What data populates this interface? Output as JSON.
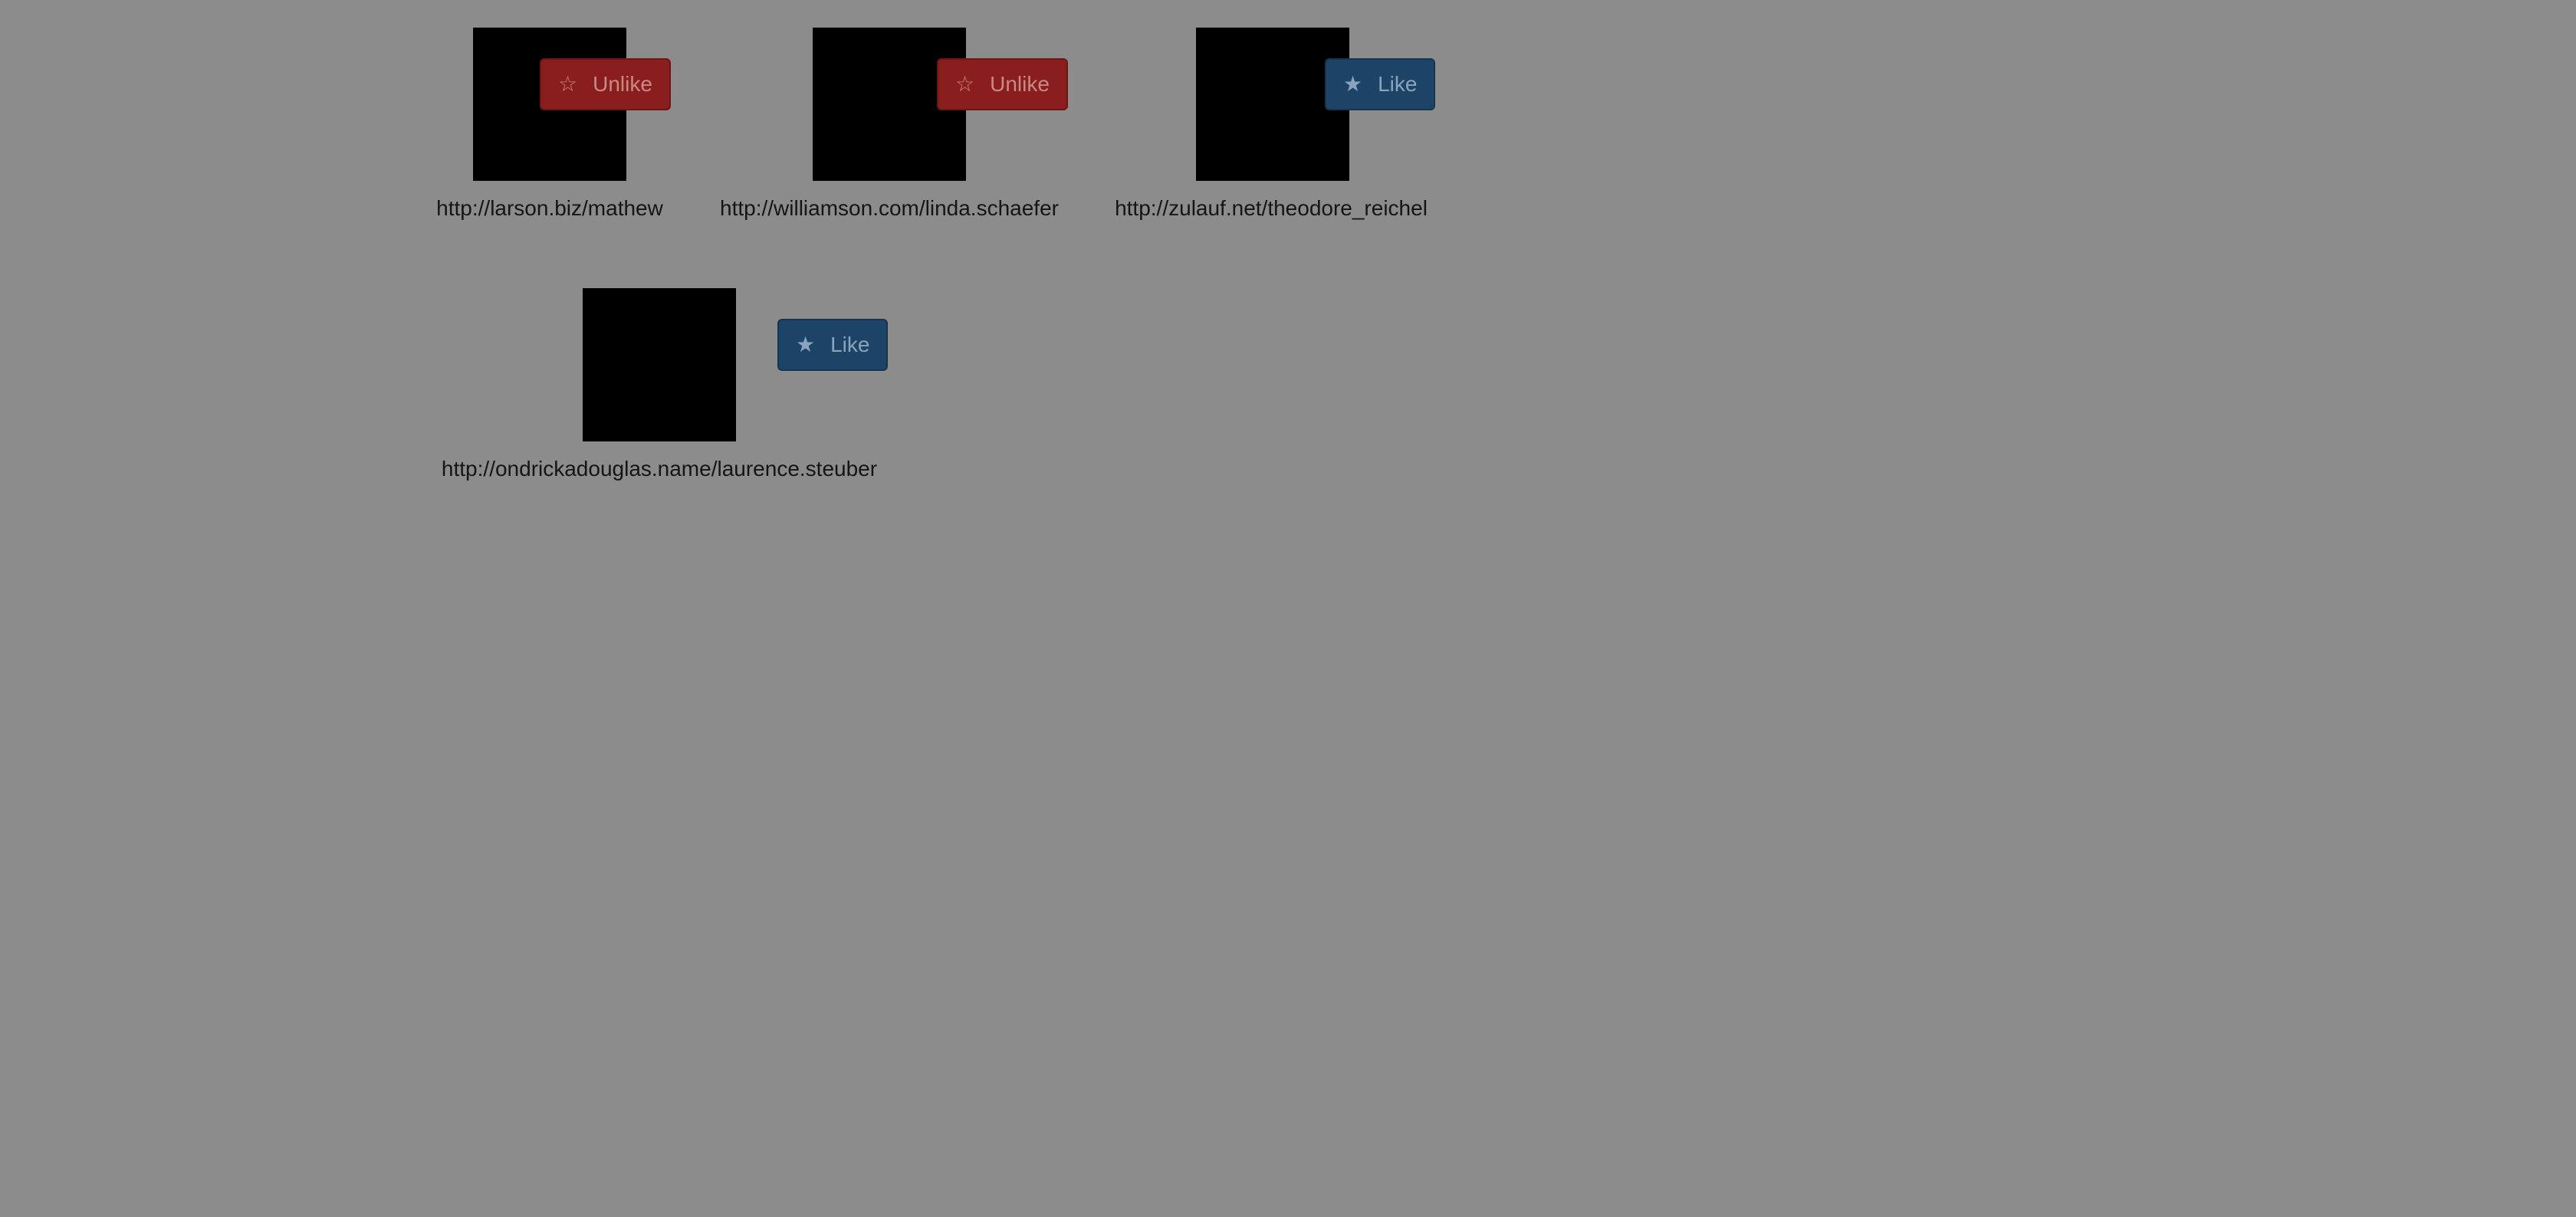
{
  "profiles": [
    {
      "url": "http://larson.biz/mathew",
      "button": {
        "label": "Unlike",
        "icon": "star-outline-icon",
        "glyph": "☆",
        "state": "liked"
      }
    },
    {
      "url": "http://williamson.com/linda.schaefer",
      "button": {
        "label": "Unlike",
        "icon": "star-outline-icon",
        "glyph": "☆",
        "state": "liked"
      }
    },
    {
      "url": "http://zulauf.net/theodore_reichel",
      "button": {
        "label": "Like",
        "icon": "star-filled-icon",
        "glyph": "★",
        "state": "not-liked"
      }
    },
    {
      "url": "http://ondrickadouglas.name/laurence.steuber",
      "button": {
        "label": "Like",
        "icon": "star-filled-icon",
        "glyph": "★",
        "state": "not-liked"
      }
    }
  ],
  "colors": {
    "background": "#8c8c8c",
    "unlike_button": "#8a1d1d",
    "like_button": "#1d4466",
    "thumbnail": "#000000"
  }
}
